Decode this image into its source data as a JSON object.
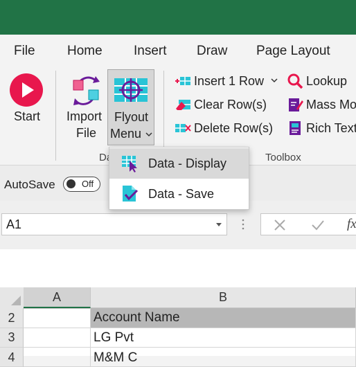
{
  "tabs": [
    "File",
    "Home",
    "Insert",
    "Draw",
    "Page Layout"
  ],
  "ribbon": {
    "start_label": "Start",
    "import_label_line1": "Import",
    "import_label_line2": "File",
    "flyout_label_line1": "Flyout",
    "flyout_label_line2": "Menu",
    "group_data_label": "Da",
    "group_toolbox_label": "Toolbox",
    "insert_row_label": "Insert 1 Row",
    "clear_rows_label": "Clear Row(s)",
    "delete_rows_label": "Delete Row(s)",
    "lookup_label": "Lookup",
    "mass_label": "Mass Mo",
    "richtext_label": "Rich Text"
  },
  "flyout_menu": {
    "items": [
      {
        "label": "Data - Display",
        "icon": "cursor-grid-icon"
      },
      {
        "label": "Data - Save",
        "icon": "document-check-icon"
      }
    ]
  },
  "autosave": {
    "label": "AutoSave",
    "state": "Off"
  },
  "formula_bar": {
    "namebox_value": "A1",
    "fx": "fx"
  },
  "grid": {
    "columns": [
      "A",
      "B"
    ],
    "rows": [
      {
        "num": "2",
        "a": "",
        "b": "Account Name"
      },
      {
        "num": "3",
        "a": "",
        "b": "LG Pvt"
      },
      {
        "num": "4",
        "a": "",
        "b": "M&M C"
      }
    ]
  },
  "colors": {
    "accent": "#217346",
    "start": "#e6004c",
    "purple": "#6a1b9a",
    "cyan": "#1ec8d8"
  }
}
